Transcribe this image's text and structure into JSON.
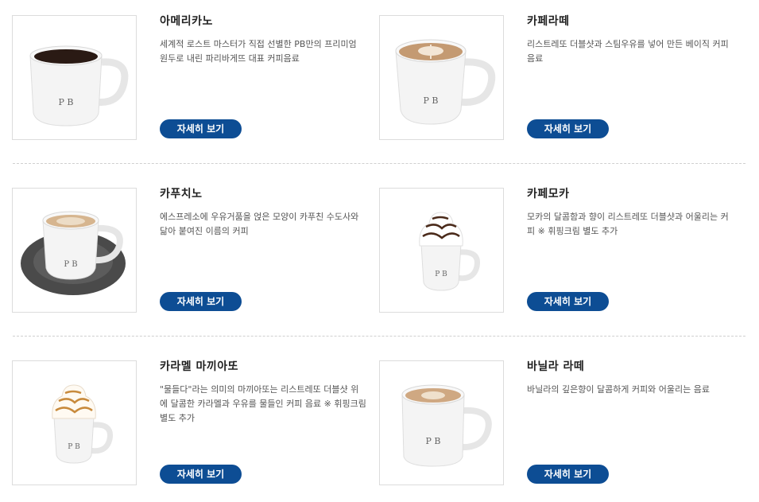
{
  "menu": [
    {
      "name": "아메리카노",
      "desc": "세계적 로스트 마스터가 직접 선별한 PB만의 프리미엄 원두로 내린 파리바게뜨 대표 커피음료",
      "button": "자세히 보기",
      "logo": "P B"
    },
    {
      "name": "카페라떼",
      "desc": "리스트레또 더블샷과 스팀우유를 넣어 만든 베이직 커피 음료",
      "button": "자세히 보기",
      "logo": "P B"
    },
    {
      "name": "카푸치노",
      "desc": "에스프레소에 우유거품을 얹은 모양이 카푸친 수도사와 닮아 붙여진 이름의 커피",
      "button": "자세히 보기",
      "logo": "P B"
    },
    {
      "name": "카페모카",
      "desc": "모카의 달콤함과 향이 리스트레또 더블샷과 어울리는 커피 ※ 휘핑크림 별도 추가",
      "button": "자세히 보기",
      "logo": "P B"
    },
    {
      "name": "카라멜 마끼아또",
      "desc": "\"물들다\"라는 의미의 마끼아또는 리스트레또 더블샷 위에 달콤한 카라멜과 우유를 물들인 커피 음료 ※ 휘핑크림 별도 추가",
      "button": "자세히 보기",
      "logo": "P B"
    },
    {
      "name": "바닐라 라떼",
      "desc": "바닐라의 깊은향이 달콤하게 커피와 어울리는 음료",
      "button": "자세히 보기",
      "logo": "P B"
    }
  ],
  "colors": {
    "button": "#0d4d94",
    "separator": "#cfcfcf"
  }
}
